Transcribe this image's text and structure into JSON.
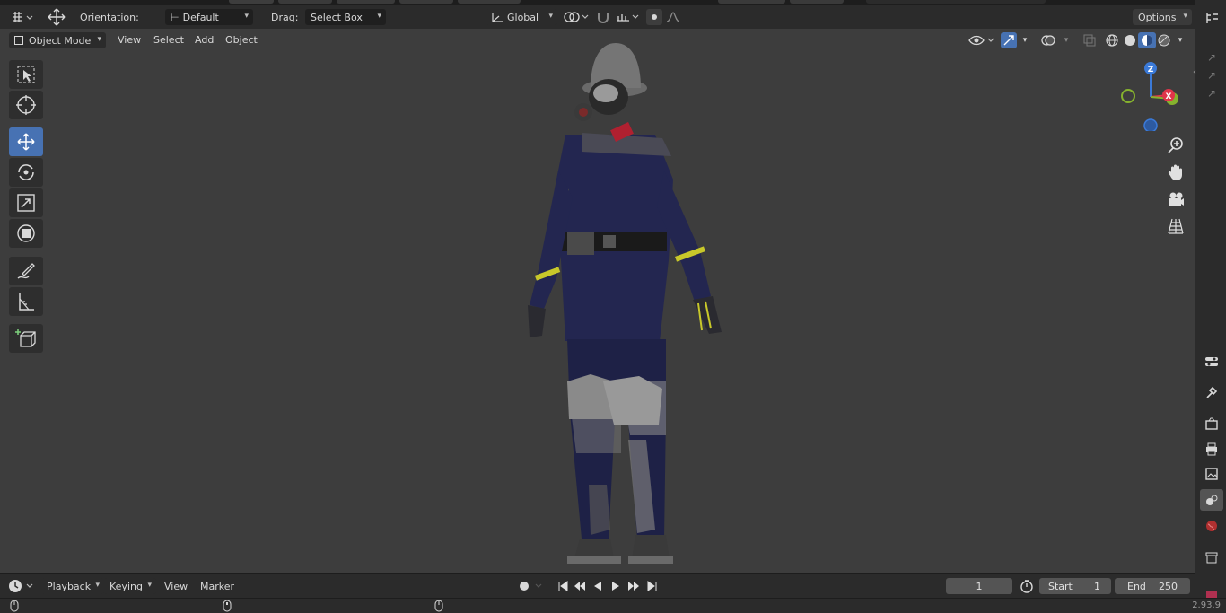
{
  "tool_header": {
    "orientation_label": "Orientation:",
    "orientation_value": "Default",
    "drag_label": "Drag:",
    "drag_value": "Select Box",
    "transform_orientation": "Global",
    "options_label": "Options"
  },
  "viewport_header": {
    "mode": "Object Mode",
    "menus": [
      "View",
      "Select",
      "Add",
      "Object"
    ]
  },
  "gizmo": {
    "z": "Z",
    "x": "X"
  },
  "timeline": {
    "menus": [
      "Playback",
      "Keying",
      "View",
      "Marker"
    ],
    "current_frame": "1",
    "start_label": "Start",
    "start_value": "1",
    "end_label": "End",
    "end_value": "250"
  },
  "status": {
    "version": "2.93.9"
  },
  "colors": {
    "accent": "#4772b3",
    "viewport_bg": "#3d3d3d",
    "header_bg": "#2b2b2b",
    "axis_x": "#e0344a",
    "axis_y": "#86b22e",
    "axis_z": "#3b7ad8"
  }
}
